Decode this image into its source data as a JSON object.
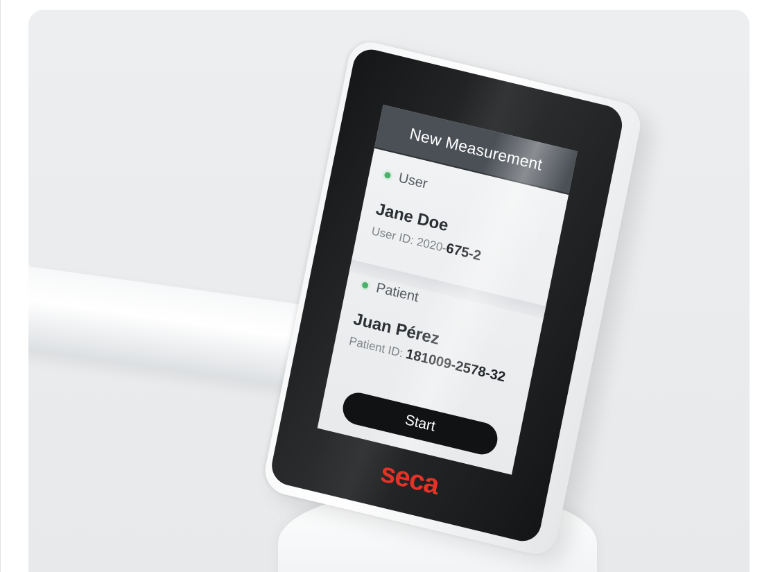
{
  "screen": {
    "title": "New Measurement",
    "user": {
      "label": "User",
      "name": "Jane Doe",
      "id_prefix": "User ID: 2020-",
      "id_bold": "675-2"
    },
    "patient": {
      "label": "Patient",
      "name": "Juan Pérez",
      "id_prefix": "Patient ID: ",
      "id_bold": "181009-2578-32"
    },
    "start_label": "Start"
  },
  "brand": {
    "logo_text": "seca",
    "logo_color": "#e53227"
  },
  "colors": {
    "status_ok": "#4caf6b",
    "header_bg": "#4b5057",
    "button_bg": "#111213"
  }
}
